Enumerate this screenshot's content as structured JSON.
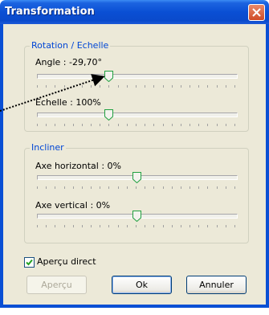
{
  "window": {
    "title": "Transformation"
  },
  "rotation_group": {
    "legend": "Rotation / Echelle",
    "angle_label": "Angle : -29,70°",
    "echelle_label": "Echelle : 100%"
  },
  "incliner_group": {
    "legend": "Incliner",
    "horizontal_label": "Axe horizontal : 0%",
    "vertical_label": "Axe vertical : 0%"
  },
  "sliders": {
    "angle": 0.36,
    "echelle": 0.36,
    "axe_horizontal": 0.5,
    "axe_vertical": 0.5
  },
  "apercu_direct": {
    "label": "Aperçu direct",
    "checked": true
  },
  "buttons": {
    "apercu": "Aperçu",
    "ok": "Ok",
    "annuler": "Annuler"
  },
  "colors": {
    "title_bar": "#0a4fd4",
    "legend": "#0046d5",
    "dialog_bg": "#ece9d8"
  }
}
